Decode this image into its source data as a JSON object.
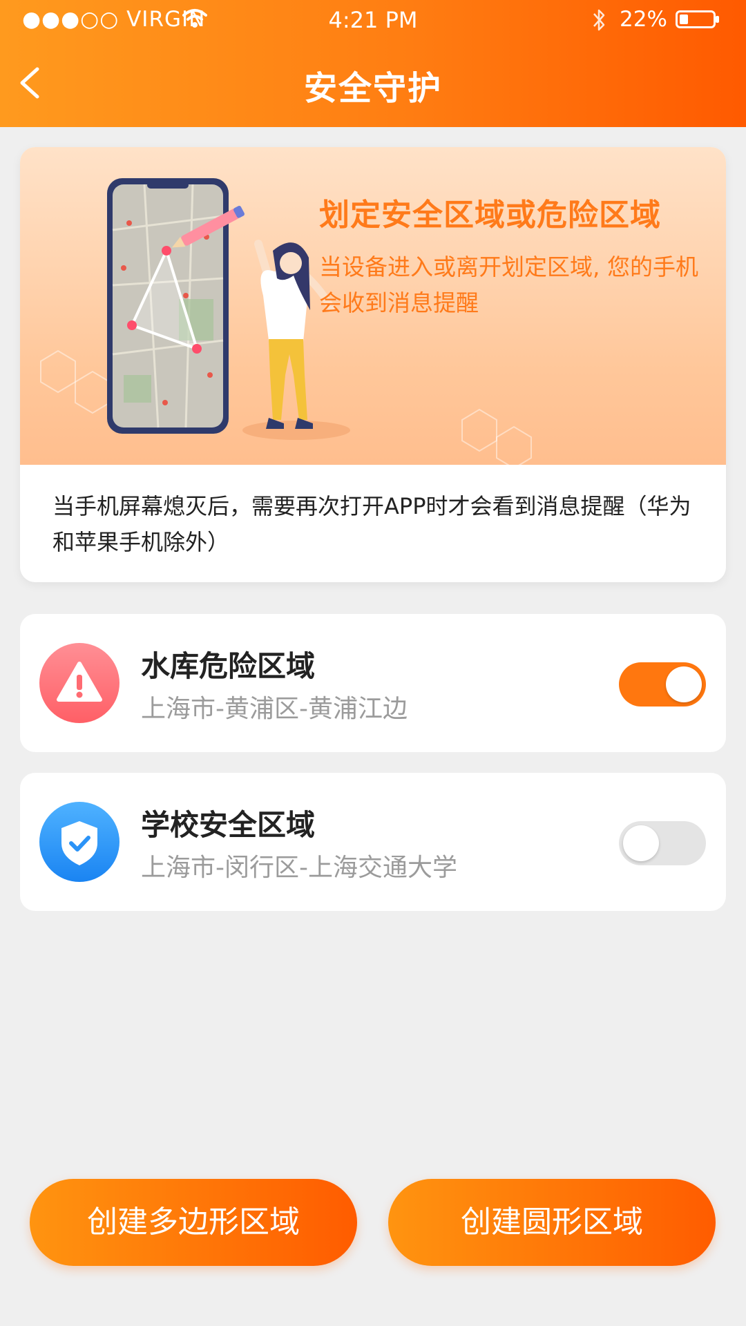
{
  "status_bar": {
    "carrier": "●●●○○ VIRGIN",
    "time": "4:21 PM",
    "battery": "22%",
    "icons": [
      "wifi-icon",
      "bluetooth-icon",
      "battery-icon"
    ]
  },
  "nav": {
    "title": "安全守护",
    "back_icon": "chevron-left-icon"
  },
  "banner": {
    "heading": "划定安全区域或危险区域",
    "subtitle": "当设备进入或离开划定区域, 您的手机会收到消息提醒",
    "note": "当手机屏幕熄灭后，需要再次打开APP时才会看到消息提醒（华为和苹果手机除外）"
  },
  "zones": [
    {
      "name": "水库危险区域",
      "address": "上海市-黄浦区-黄浦江边",
      "icon": "warning-icon",
      "enabled": true
    },
    {
      "name": "学校安全区域",
      "address": "上海市-闵行区-上海交通大学",
      "icon": "shield-check-icon",
      "enabled": false
    }
  ],
  "buttons": {
    "create_polygon": "创建多边形区域",
    "create_circle": "创建圆形区域"
  },
  "colors": {
    "brand_orange": "#ff7d12",
    "danger": "#ff6b72",
    "safe": "#2b93f7"
  }
}
